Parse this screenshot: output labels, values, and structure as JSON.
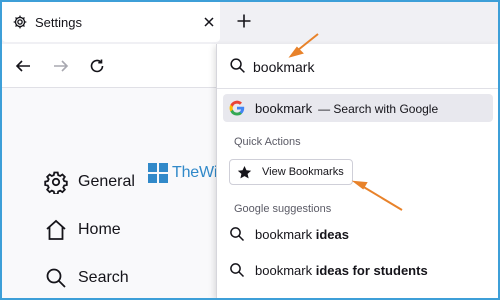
{
  "tab": {
    "title": "Settings",
    "close_icon": "close-icon",
    "new_tab_icon": "plus-icon"
  },
  "toolbar": {
    "back_icon": "back-arrow-icon",
    "forward_icon": "forward-arrow-icon",
    "reload_icon": "reload-icon"
  },
  "sidebar": {
    "items": [
      {
        "label": "General",
        "icon": "gear-icon"
      },
      {
        "label": "Home",
        "icon": "home-icon"
      },
      {
        "label": "Search",
        "icon": "search-icon"
      }
    ]
  },
  "watermark": {
    "text": "TheWindowsClub"
  },
  "urlbar": {
    "value": "bookmark",
    "google_suggestion": {
      "query": "bookmark",
      "engine_text": "— Search with Google"
    },
    "quick_actions_label": "Quick Actions",
    "quick_action_button": "View Bookmarks",
    "google_suggestions_label": "Google suggestions",
    "suggestions": [
      {
        "prefix": "bookmark",
        "bold": "ideas"
      },
      {
        "prefix": "bookmark",
        "bold": "ideas for students"
      }
    ]
  },
  "colors": {
    "accent_frame": "#3d9fd8",
    "annotation_arrow": "#e8822a",
    "watermark": "#3189c9",
    "selected_row": "#e8e8ee"
  }
}
